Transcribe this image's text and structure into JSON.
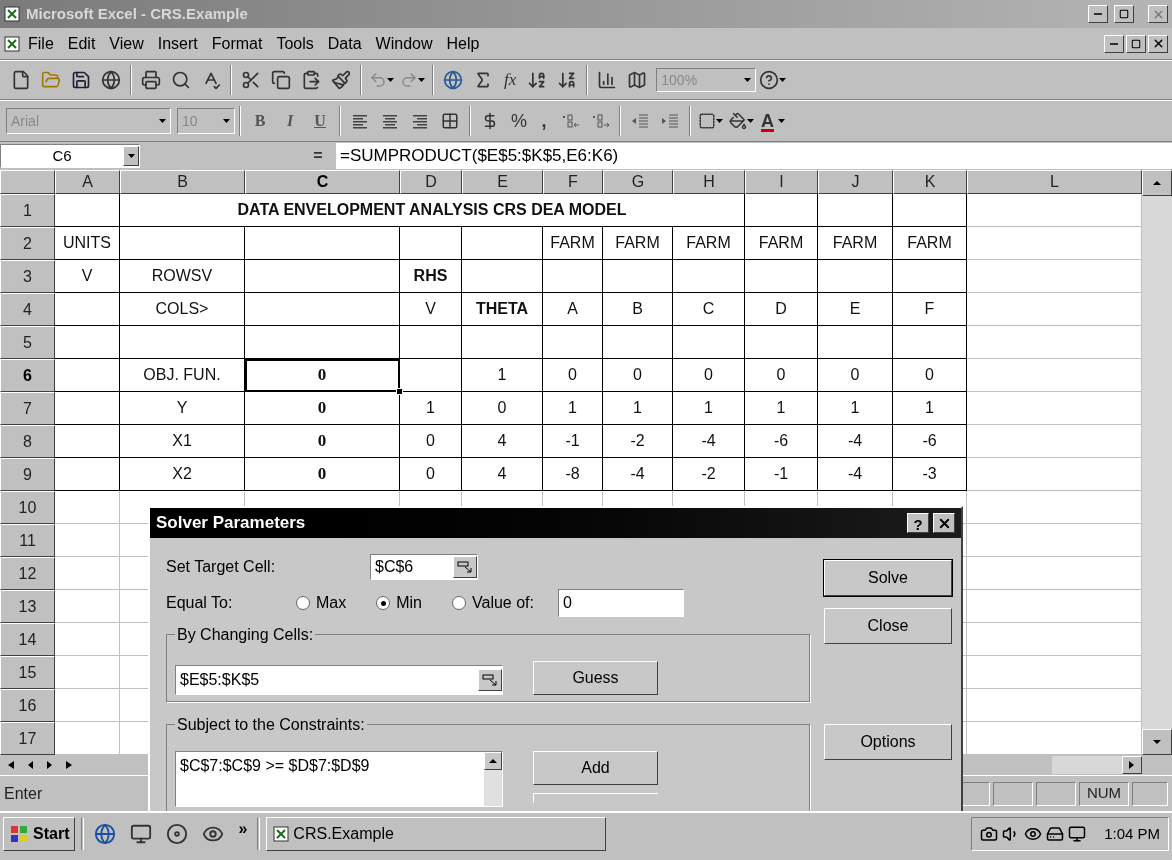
{
  "window": {
    "title": "Microsoft Excel - CRS.Example"
  },
  "menu": [
    {
      "label": "File"
    },
    {
      "label": "Edit"
    },
    {
      "label": "View"
    },
    {
      "label": "Insert"
    },
    {
      "label": "Format"
    },
    {
      "label": "Tools"
    },
    {
      "label": "Data"
    },
    {
      "label": "Window"
    },
    {
      "label": "Help"
    }
  ],
  "standard_toolbar": {
    "function_label": "fx",
    "zoom": "100%"
  },
  "formatting_toolbar": {
    "font": "Arial",
    "size": "10",
    "bold": "B",
    "italic": "I",
    "underline": "U",
    "percent": "%",
    "comma": ",",
    "font_color": "A"
  },
  "formula_bar": {
    "name_box": "C6",
    "equals": "=",
    "formula": "=SUMPRODUCT($E$5:$K$5,E6:K6)"
  },
  "sheet": {
    "columns": [
      {
        "label": "A",
        "selected": false
      },
      {
        "label": "B",
        "selected": false
      },
      {
        "label": "C",
        "selected": true
      },
      {
        "label": "D",
        "selected": false
      },
      {
        "label": "E",
        "selected": false
      },
      {
        "label": "F",
        "selected": false
      },
      {
        "label": "G",
        "selected": false
      },
      {
        "label": "H",
        "selected": false
      },
      {
        "label": "I",
        "selected": false
      },
      {
        "label": "J",
        "selected": false
      },
      {
        "label": "K",
        "selected": false
      },
      {
        "label": "L",
        "selected": false
      }
    ],
    "rows": [
      {
        "number": "1",
        "selected": false,
        "cells": [
          null,
          {
            "text": "DATA ENVELOPMENT ANALYSIS CRS DEA MODEL",
            "bold": true,
            "kind": "title"
          },
          null,
          null,
          null,
          null,
          null,
          null,
          null,
          null,
          null,
          null
        ]
      },
      {
        "number": "2",
        "selected": false,
        "cells": [
          {
            "text": "UNITS",
            "bold": false
          },
          null,
          null,
          null,
          null,
          {
            "text": "FARM",
            "bold": false
          },
          {
            "text": "FARM",
            "bold": false
          },
          {
            "text": "FARM",
            "bold": false
          },
          {
            "text": "FARM",
            "bold": false
          },
          {
            "text": "FARM",
            "bold": false
          },
          {
            "text": "FARM",
            "bold": false
          },
          null
        ]
      },
      {
        "number": "3",
        "selected": false,
        "cells": [
          {
            "text": "V",
            "bold": false
          },
          {
            "text": "ROWSV",
            "bold": false
          },
          null,
          {
            "text": "RHS",
            "bold": true
          },
          null,
          null,
          null,
          null,
          null,
          null,
          null,
          null
        ]
      },
      {
        "number": "4",
        "selected": false,
        "cells": [
          null,
          {
            "text": "COLS>",
            "bold": false
          },
          null,
          {
            "text": "V",
            "bold": false
          },
          {
            "text": "THETA",
            "bold": true
          },
          {
            "text": "A",
            "bold": false
          },
          {
            "text": "B",
            "bold": false
          },
          {
            "text": "C",
            "bold": false
          },
          {
            "text": "D",
            "bold": false
          },
          {
            "text": "E",
            "bold": false
          },
          {
            "text": "F",
            "bold": false
          },
          null
        ]
      },
      {
        "number": "5",
        "selected": false
      },
      {
        "number": "6",
        "selected": true,
        "cells": [
          null,
          {
            "text": "OBJ. FUN.",
            "bold": false
          },
          {
            "text": "0",
            "bold": true
          },
          null,
          {
            "text": "1",
            "bold": false
          },
          {
            "text": "0",
            "bold": false
          },
          {
            "text": "0",
            "bold": false
          },
          {
            "text": "0",
            "bold": false
          },
          {
            "text": "0",
            "bold": false
          },
          {
            "text": "0",
            "bold": false
          },
          {
            "text": "0",
            "bold": false
          },
          null
        ]
      },
      {
        "number": "7",
        "selected": false,
        "cells": [
          null,
          {
            "text": "Y",
            "bold": false
          },
          {
            "text": "0",
            "bold": true
          },
          {
            "text": "1",
            "bold": false
          },
          {
            "text": "0",
            "bold": false
          },
          {
            "text": "1",
            "bold": false
          },
          {
            "text": "1",
            "bold": false
          },
          {
            "text": "1",
            "bold": false
          },
          {
            "text": "1",
            "bold": false
          },
          {
            "text": "1",
            "bold": false
          },
          {
            "text": "1",
            "bold": false
          },
          null
        ]
      },
      {
        "number": "8",
        "selected": false,
        "cells": [
          null,
          {
            "text": "X1",
            "bold": false
          },
          {
            "text": "0",
            "bold": true
          },
          {
            "text": "0",
            "bold": false
          },
          {
            "text": "4",
            "bold": false
          },
          {
            "text": "-1",
            "bold": false
          },
          {
            "text": "-2",
            "bold": false
          },
          {
            "text": "-4",
            "bold": false
          },
          {
            "text": "-6",
            "bold": false
          },
          {
            "text": "-4",
            "bold": false
          },
          {
            "text": "-6",
            "bold": false
          },
          null
        ]
      },
      {
        "number": "9",
        "selected": false,
        "cells": [
          null,
          {
            "text": "X2",
            "bold": false
          },
          {
            "text": "0",
            "bold": true
          },
          {
            "text": "0",
            "bold": false
          },
          {
            "text": "4",
            "bold": false
          },
          {
            "text": "-8",
            "bold": false
          },
          {
            "text": "-4",
            "bold": false
          },
          {
            "text": "-2",
            "bold": false
          },
          {
            "text": "-1",
            "bold": false
          },
          {
            "text": "-4",
            "bold": false
          },
          {
            "text": "-3",
            "bold": false
          },
          null
        ]
      },
      {
        "number": "10",
        "selected": false
      },
      {
        "number": "11",
        "selected": false
      },
      {
        "number": "12",
        "selected": false
      },
      {
        "number": "13",
        "selected": false
      },
      {
        "number": "14",
        "selected": false
      },
      {
        "number": "15",
        "selected": false
      },
      {
        "number": "16",
        "selected": false
      },
      {
        "number": "17",
        "selected": false
      }
    ]
  },
  "solver_dialog": {
    "title": "Solver Parameters",
    "help": "?",
    "target_label": "Set Target Cell:",
    "target_value": "$C$6",
    "equal_to_label": "Equal To:",
    "options": [
      {
        "label": "Max",
        "selected": false
      },
      {
        "label": "Min",
        "selected": true
      },
      {
        "label": "Value of:",
        "selected": false
      }
    ],
    "value_field": "0",
    "changing_label": "By Changing Cells:",
    "changing_value": "$E$5:$K$5",
    "constraints_label": "Subject to the Constraints:",
    "constraints": [
      "$C$7:$C$9 >= $D$7:$D$9"
    ],
    "buttons": {
      "solve": "Solve",
      "close": "Close",
      "options": "Options",
      "guess": "Guess",
      "add": "Add"
    }
  },
  "status_bar": {
    "mode": "Enter",
    "indicators": [
      "NUM"
    ]
  },
  "taskbar": {
    "start": "Start",
    "more": "»",
    "tasks": [
      {
        "label": "CRS.Example",
        "selected": false
      }
    ],
    "clock": "1:04 PM"
  }
}
